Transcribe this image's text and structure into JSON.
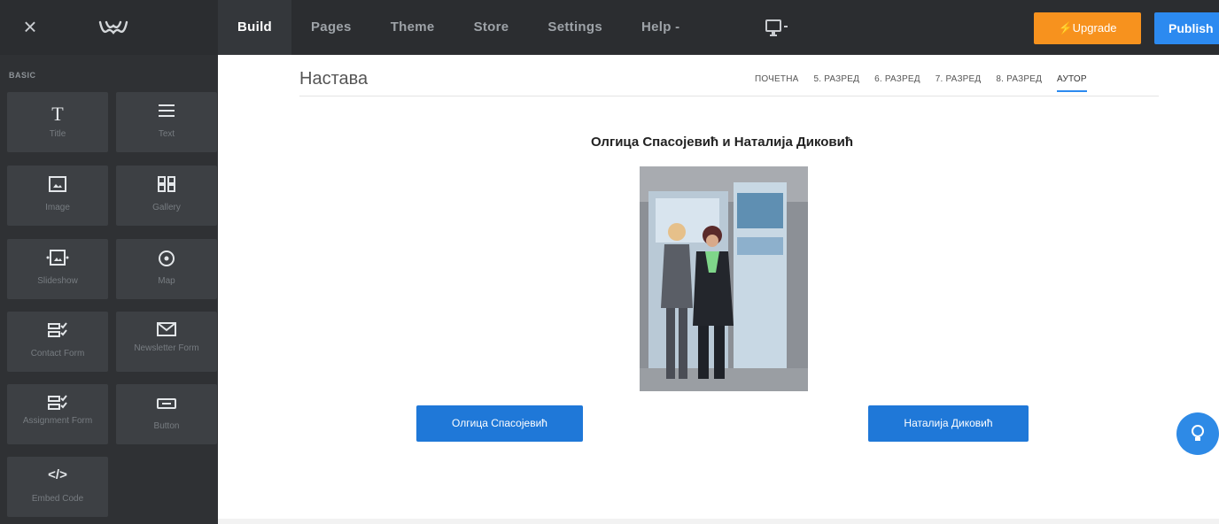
{
  "topbar": {
    "close_label": "×",
    "nav": [
      "Build",
      "Pages",
      "Theme",
      "Store",
      "Settings",
      "Help -"
    ],
    "active_nav": "Build",
    "device_icon": "desktop-preview-icon",
    "upgrade_label": "Upgrade",
    "publish_label": "Publish",
    "colors": {
      "upgrade": "#f7921e",
      "publish": "#2c8af0"
    }
  },
  "sidebar": {
    "section_label": "BASIC",
    "tiles": [
      {
        "label": "Title",
        "icon": "title-icon"
      },
      {
        "label": "Text",
        "icon": "text-icon"
      },
      {
        "label": "Image",
        "icon": "image-icon"
      },
      {
        "label": "Gallery",
        "icon": "gallery-icon"
      },
      {
        "label": "Slideshow",
        "icon": "slideshow-icon"
      },
      {
        "label": "Map",
        "icon": "map-icon"
      },
      {
        "label": "Contact Form",
        "icon": "contact-form-icon"
      },
      {
        "label": "Newsletter Form",
        "icon": "newsletter-icon"
      },
      {
        "label": "Assignment Form",
        "icon": "assignment-form-icon"
      },
      {
        "label": "Button",
        "icon": "button-icon"
      },
      {
        "label": "Embed Code",
        "icon": "embed-code-icon"
      }
    ]
  },
  "site": {
    "title": "Настава",
    "nav": [
      "ПОЧЕТНА",
      "5. РАЗРЕД",
      "6. РАЗРЕД",
      "7. РАЗРЕД",
      "8. РАЗРЕД",
      "АУТОР"
    ],
    "active_nav": "АУТОР",
    "heading": "Олгица Спасојевић и Наталија Диковић",
    "button_left": "Олгица Спасојевић",
    "button_right": "Наталија Диковић",
    "accent": "#1f78d8"
  }
}
